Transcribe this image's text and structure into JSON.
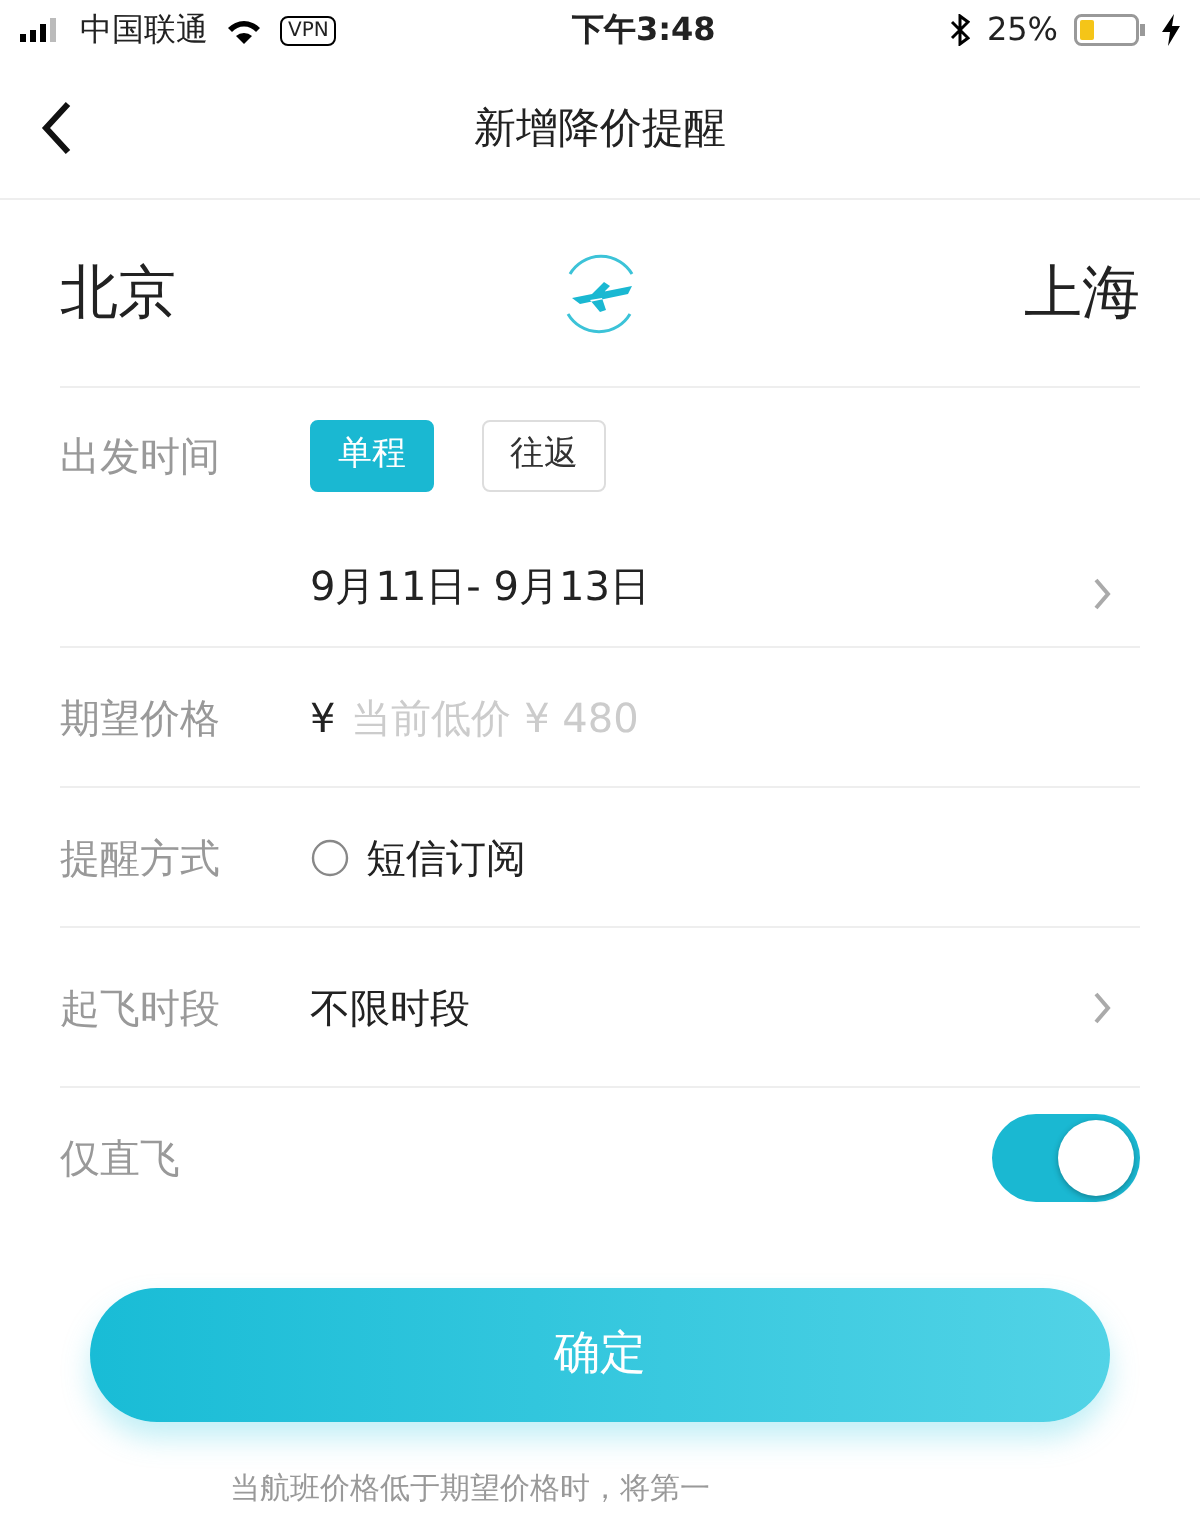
{
  "status_bar": {
    "carrier": "中国联通",
    "vpn": "VPN",
    "time": "下午3:48",
    "battery": "25%"
  },
  "nav": {
    "title": "新增降价提醒"
  },
  "route": {
    "from": "北京",
    "to": "上海"
  },
  "departure": {
    "label": "出发时间",
    "options": [
      {
        "label": "单程",
        "selected": true
      },
      {
        "label": "往返",
        "selected": false
      }
    ],
    "dates": "9月11日- 9月13日"
  },
  "price": {
    "label": "期望价格",
    "currency": "¥",
    "placeholder": "当前低价 ¥ 480"
  },
  "reminder": {
    "label": "提醒方式",
    "option": {
      "label": "短信订阅",
      "checked": false
    }
  },
  "time_slot": {
    "label": "起飞时段",
    "value": "不限时段"
  },
  "direct": {
    "label": "仅直飞",
    "on": true
  },
  "confirm": "确定",
  "note": "当航班价格低于期望价格时，将第一"
}
